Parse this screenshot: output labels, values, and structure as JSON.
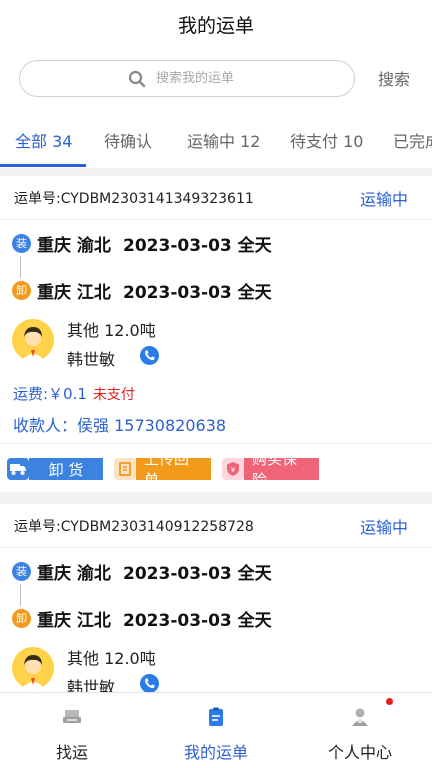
{
  "header": {
    "title": "我的运单"
  },
  "search": {
    "placeholder": "搜索我的运单",
    "button_label": "搜索"
  },
  "tabs": [
    {
      "label": "全部 34",
      "active": true
    },
    {
      "label": "待确认",
      "active": false
    },
    {
      "label": "运输中 12",
      "active": false
    },
    {
      "label": "待支付 10",
      "active": false
    },
    {
      "label": "已完成",
      "active": false
    }
  ],
  "orders": [
    {
      "order_no": "运单号:CYDBM2303141349323611",
      "status": "运输中",
      "load_badge": "装",
      "load_city": "重庆 渝北",
      "load_date": "2023-03-03 全天",
      "unload_badge": "卸",
      "unload_city": "重庆 江北",
      "unload_date": "2023-03-03 全天",
      "cargo": "其他  12.0吨",
      "driver": "韩世敏",
      "fee": "运费:￥0.1",
      "fee_status": "未支付",
      "payee": "收款人：侯强  15730820638",
      "actions": [
        {
          "label": "卸  货",
          "color": "#3c82e0"
        },
        {
          "label": "上传回单",
          "color": "#f29a1b"
        },
        {
          "label": "购买保险",
          "color": "#f0647a"
        }
      ]
    },
    {
      "order_no": "运单号:CYDBM2303140912258728",
      "status": "运输中",
      "load_badge": "装",
      "load_city": "重庆 渝北",
      "load_date": "2023-03-03 全天",
      "unload_badge": "卸",
      "unload_city": "重庆 江北",
      "unload_date": "2023-03-03 全天",
      "cargo": "其他  12.0吨",
      "driver": "韩世敏"
    }
  ],
  "bottom_nav": [
    {
      "label": "找运",
      "icon": "truck-icon",
      "active": false
    },
    {
      "label": "我的运单",
      "icon": "waybill-icon",
      "active": true
    },
    {
      "label": "个人中心",
      "icon": "person-icon",
      "active": false
    }
  ],
  "colors": {
    "accent": "#2b5fd3",
    "unpaid": "#e02020",
    "badge_load": "#3c82e0",
    "badge_unload": "#f29a1b"
  }
}
